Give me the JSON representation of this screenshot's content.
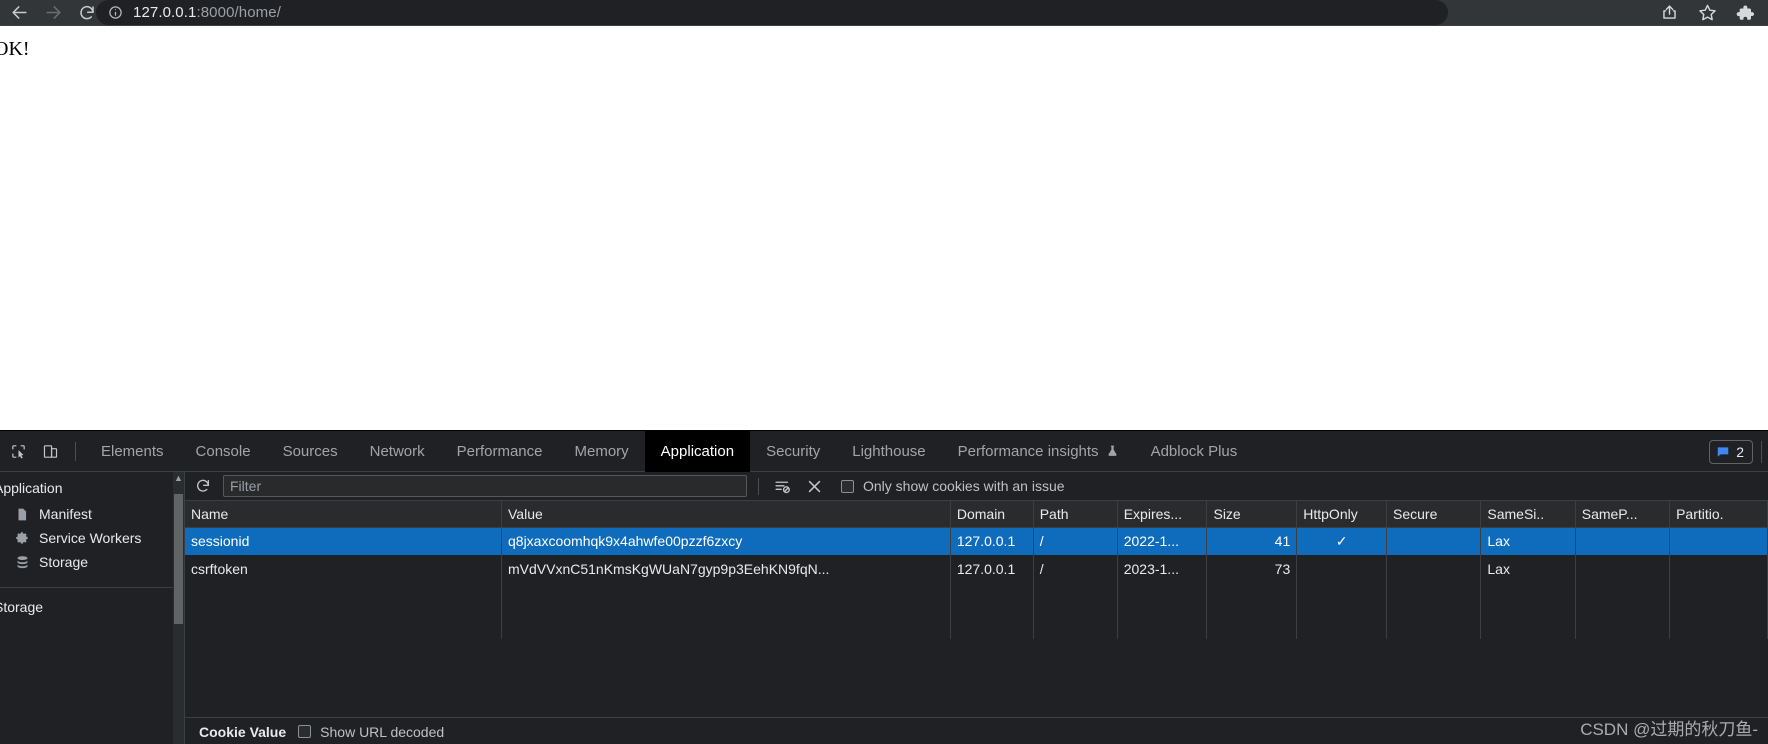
{
  "browser": {
    "back_icon": "arrow-left-icon",
    "forward_icon": "arrow-right-icon",
    "reload_icon": "reload-icon",
    "info_icon": "info-circle-icon",
    "url_host": "127.0.0.1",
    "url_rest": ":8000/home/",
    "share_icon": "share-icon",
    "bookmark_icon": "star-icon",
    "extensions_icon": "puzzle-piece-icon"
  },
  "page": {
    "body_text": "OK!"
  },
  "devtools": {
    "inspect_icon": "inspect-element-icon",
    "device_toggle_icon": "device-toolbar-icon",
    "tabs": [
      {
        "label": "Elements",
        "active": false
      },
      {
        "label": "Console",
        "active": false
      },
      {
        "label": "Sources",
        "active": false
      },
      {
        "label": "Network",
        "active": false
      },
      {
        "label": "Performance",
        "active": false
      },
      {
        "label": "Memory",
        "active": false
      },
      {
        "label": "Application",
        "active": true
      },
      {
        "label": "Security",
        "active": false
      },
      {
        "label": "Lighthouse",
        "active": false
      },
      {
        "label": "Performance insights",
        "active": false,
        "suffix_icon": "flask-icon"
      },
      {
        "label": "Adblock Plus",
        "active": false
      }
    ],
    "issues": {
      "icon": "message-icon",
      "count": "2"
    },
    "sidebar": {
      "section_application": "Application",
      "items": [
        {
          "label": "Manifest",
          "icon": "document-icon"
        },
        {
          "label": "Service Workers",
          "icon": "gear-icon"
        },
        {
          "label": "Storage",
          "icon": "database-icon"
        }
      ],
      "section_storage": "Storage"
    },
    "toolbar": {
      "refresh_icon": "refresh-icon",
      "filter_value": "",
      "filter_placeholder": "Filter",
      "clear_filtered_icon": "clear-filtered-cookies-icon",
      "delete_icon": "close-x-icon",
      "only_issues_label": "Only show cookies with an issue",
      "only_issues_checked": false
    },
    "cookie_table": {
      "columns": [
        "Name",
        "Value",
        "Domain",
        "Path",
        "Expires...",
        "Size",
        "HttpOnly",
        "Secure",
        "SameSi..",
        "SameP...",
        "Partitio."
      ],
      "rows": [
        {
          "selected": true,
          "name": "sessionid",
          "value": "q8jxaxcoomhqk9x4ahwfe00pzzf6zxcy",
          "domain": "127.0.0.1",
          "path": "/",
          "expires": "2022-1...",
          "size": "41",
          "http_only": "✓",
          "secure": "",
          "same_site": "Lax",
          "same_party": "",
          "partition_key": ""
        },
        {
          "selected": false,
          "name": "csrftoken",
          "value": "mVdVVxnC51nKmsKgWUaN7gyp9p3EehKN9fqN...",
          "domain": "127.0.0.1",
          "path": "/",
          "expires": "2023-1...",
          "size": "73",
          "http_only": "",
          "secure": "",
          "same_site": "Lax",
          "same_party": "",
          "partition_key": ""
        }
      ]
    },
    "cookie_value_panel": {
      "title": "Cookie Value",
      "show_url_decoded_label": "Show URL decoded",
      "show_url_decoded_checked": false
    }
  },
  "watermark": "CSDN @过期的秋刀鱼-"
}
